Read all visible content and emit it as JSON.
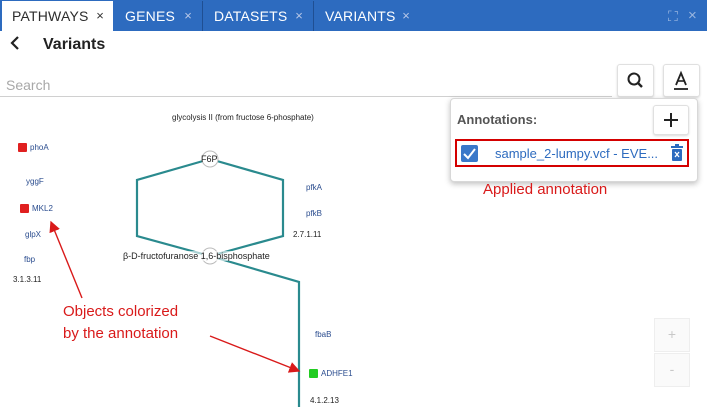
{
  "tabs": [
    {
      "label": "PATHWAYS",
      "close": "×",
      "active": true
    },
    {
      "label": "GENES",
      "close": "×",
      "active": false
    },
    {
      "label": "DATASETS",
      "close": "×",
      "active": false
    },
    {
      "label": "VARIANTS",
      "close": "×",
      "active": false
    }
  ],
  "toolbar": {
    "expand_icon": "⛶",
    "close_icon": "×"
  },
  "header": {
    "back_icon": "‹",
    "title": "Variants"
  },
  "search": {
    "placeholder": "Search",
    "value": ""
  },
  "pathway": {
    "title": "glycolysis II (from fructose 6-phosphate)",
    "compounds": [
      "F6P",
      "β-D-fructofuranose 1,6-bisphosphate"
    ],
    "genes_left": [
      "phoA",
      "yggF",
      "MKL2",
      "glpX",
      "fbp"
    ],
    "ec_left": "3.1.3.11",
    "genes_right_top": [
      "pfkA",
      "pfkB"
    ],
    "ec_right_top": "2.7.1.11",
    "genes_right_bottom": [
      "fbaB",
      "ADHFE1"
    ],
    "ec_right_bottom": "4.1.2.13",
    "colored_genes": {
      "phoA": "#e02020",
      "MKL2": "#e02020",
      "ADHFE1": "#22cc22"
    }
  },
  "annotations": {
    "title": "Annotations:",
    "add_icon": "+",
    "items": [
      {
        "label": "sample_2-lumpy.vcf - EVE...",
        "checked": true,
        "delete_icon": "trash-icon"
      }
    ]
  },
  "notes": {
    "applied": "Applied annotation",
    "objects_line1": "Objects colorized",
    "objects_line2": "by the annotation"
  },
  "zoom": {
    "in": "+",
    "out": "-"
  },
  "colors": {
    "tabbar": "#2d6bbf",
    "edge": "#2a8a8e",
    "annotation_border": "#d40000",
    "note": "#d91a1a"
  }
}
